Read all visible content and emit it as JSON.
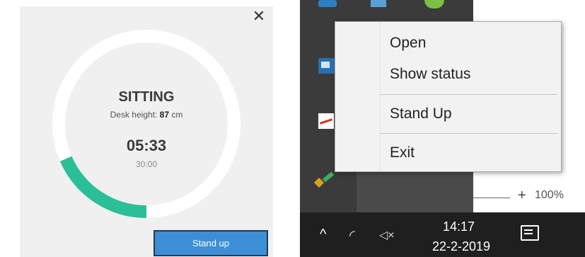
{
  "widget": {
    "close_icon": "close-icon",
    "state": "SITTING",
    "height_label": "Desk height:",
    "height_value": "87",
    "height_unit": "cm",
    "timer": "05:33",
    "target": "30:00",
    "progress": 0.185,
    "stand_button": "Stand up",
    "colors": {
      "progress": "#2bbf97",
      "ring": "#ffffff",
      "button": "#3c8fd4"
    }
  },
  "context_menu": {
    "items": [
      "Open",
      "Show status",
      "Stand Up",
      "Exit"
    ]
  },
  "window": {
    "zoom_plus": "+",
    "zoom_level": "100%"
  },
  "taskbar": {
    "time": "14:17",
    "date": "22-2-2019",
    "icons": [
      "chevron-up-icon",
      "wifi-icon",
      "volume-muted-icon",
      "notification-icon"
    ]
  }
}
